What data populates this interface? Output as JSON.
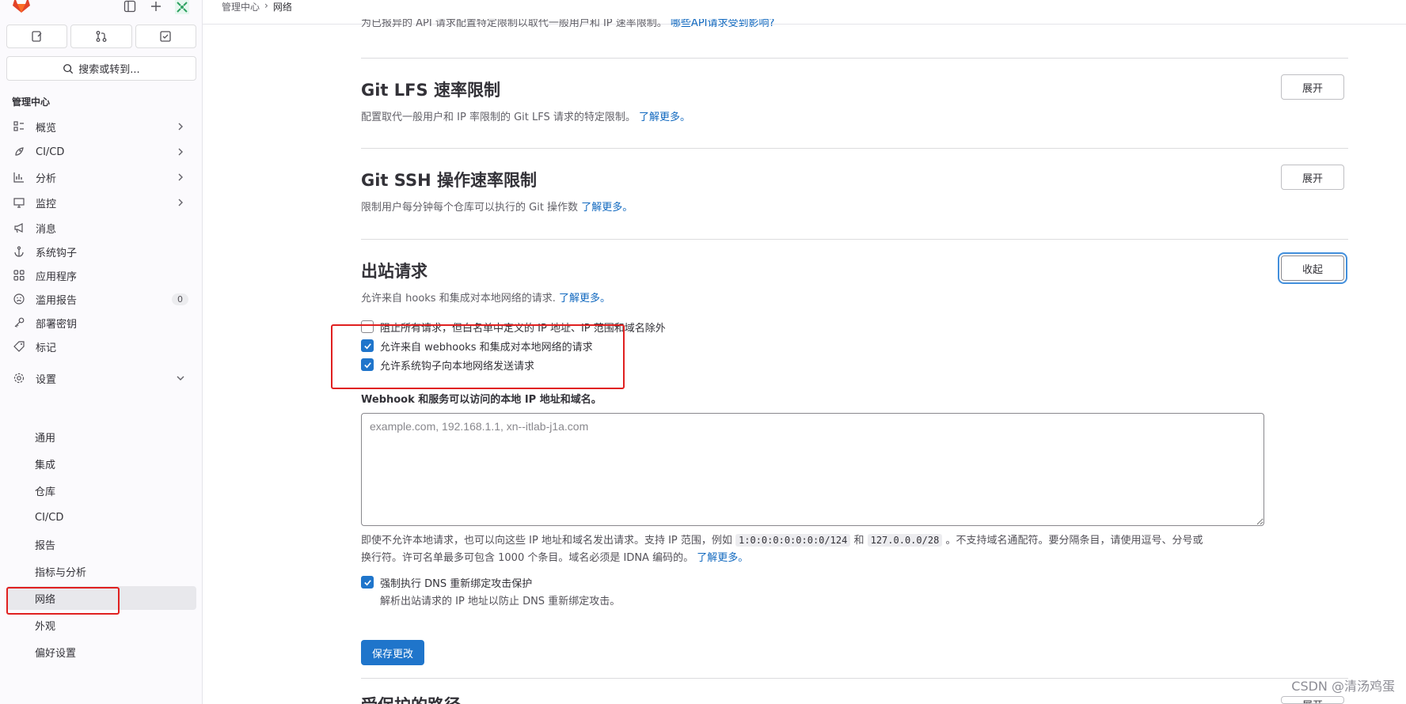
{
  "sidebar": {
    "search_label": "搜索或转到...",
    "section_title": "管理中心",
    "nav": [
      {
        "label": "概览",
        "icon": "overview-icon"
      },
      {
        "label": "CI/CD",
        "icon": "rocket-icon"
      },
      {
        "label": "分析",
        "icon": "chart-icon"
      },
      {
        "label": "监控",
        "icon": "monitor-icon"
      },
      {
        "label": "消息",
        "icon": "megaphone-icon"
      },
      {
        "label": "系统钩子",
        "icon": "anchor-icon"
      },
      {
        "label": "应用程序",
        "icon": "apps-icon"
      },
      {
        "label": "滥用报告",
        "icon": "abuse-icon",
        "badge": "0"
      },
      {
        "label": "部署密钥",
        "icon": "key-icon"
      },
      {
        "label": "标记",
        "icon": "label-icon"
      },
      {
        "label": "设置",
        "icon": "gear-icon"
      }
    ],
    "settings_items": [
      "通用",
      "集成",
      "仓库",
      "CI/CD",
      "报告",
      "指标与分析",
      "网络",
      "外观",
      "偏好设置"
    ],
    "active_item": "网络"
  },
  "breadcrumb": {
    "parent": "管理中心",
    "current": "网络"
  },
  "top_partial_text": "为已报异的 API 请求配置特定限制以取代一般用户和 IP 速率限制。",
  "top_partial_link": "哪些API请求受到影响?",
  "sections": {
    "lfs": {
      "title": "Git LFS 速率限制",
      "desc": "配置取代一般用户和 IP 率限制的 Git LFS 请求的特定限制。",
      "link": "了解更多。",
      "button": "展开"
    },
    "ssh": {
      "title": "Git SSH 操作速率限制",
      "desc": "限制用户每分钟每个仓库可以执行的 Git 操作数",
      "link": "了解更多。",
      "button": "展开"
    },
    "outbound": {
      "title": "出站请求",
      "desc": "允许来自 hooks 和集成对本地网络的请求.",
      "link": "了解更多。",
      "button": "收起",
      "checkboxes": [
        {
          "label": "阻止所有请求，但白名单中定义的 IP 地址、IP 范围和域名除外",
          "checked": false
        },
        {
          "label": "允许来自 webhooks 和集成对本地网络的请求",
          "checked": true
        },
        {
          "label": "允许系统钩子向本地网络发送请求",
          "checked": true
        }
      ],
      "allowlist_label": "Webhook 和服务可以访问的本地 IP 地址和域名。",
      "allowlist_placeholder": "example.com, 192.168.1.1, xn--itlab-j1a.com",
      "help_1": "即使不允许本地请求，也可以向这些 IP 地址和域名发出请求。支持 IP 范围，例如",
      "help_code_1": "1:0:0:0:0:0:0:0/124",
      "help_and": "和",
      "help_code_2": "127.0.0.0/28",
      "help_2": "。不支持域名通配符。要分隔条目，请使用逗号、分号或",
      "help_3": "换行符。许可名单最多可包含 1000 个条目。域名必须是 IDNA 编码的。",
      "help_link": "了解更多。",
      "dns_label": "强制执行 DNS 重新绑定攻击保护",
      "dns_checked": true,
      "dns_help": "解析出站请求的 IP 地址以防止 DNS 重新绑定攻击。",
      "save_button": "保存更改"
    },
    "next_partial_title": "受保护的路径",
    "next_partial_button": "展开"
  },
  "watermark": "CSDN @清汤鸡蛋",
  "colors": {
    "accent": "#1f75cb",
    "link": "#1068bf",
    "highlight_box": "#e02020"
  }
}
